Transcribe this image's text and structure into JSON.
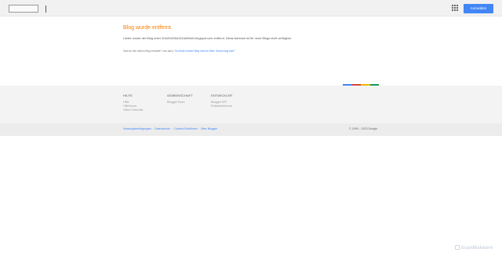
{
  "topbar": {
    "signin_label": "Anmelden",
    "apps_icon": "apps-grid-icon"
  },
  "main": {
    "title": "Blog wurde entfernt.",
    "message": "Leider wurde der Blog unter 2i1s00d23st1244e00s0l.blogspot.com entfernt. Diese Adresse ist für neue Blogs nicht verfügbar.",
    "hint_prefix": "Hast du hier deinen Blog erwartet? Lies dazu: ",
    "hint_link": "\"Ich finde meinen Blog nicht im Web. Woran liegt das?\""
  },
  "colors": {
    "accent_blue": "#4285f4",
    "title_orange": "#f57d00",
    "bar": [
      "#4285f4",
      "#db4437",
      "#f4b400",
      "#0f9d58"
    ]
  },
  "footer": {
    "columns": [
      {
        "heading": "HILFE",
        "links": [
          "Hilfe",
          "Hilfeforum",
          "Video-Tutorials"
        ]
      },
      {
        "heading": "GEMEINSCHAFT",
        "links": [
          "Blogger Buzz"
        ]
      },
      {
        "heading": "ENTWICKLER",
        "links": [
          "Blogger API",
          "Entwicklerforum"
        ]
      }
    ]
  },
  "legal": {
    "links": [
      "Nutzungsbedingungen",
      "Datenschutz",
      "Content-Richtlinien",
      "Über Blogger"
    ],
    "copyright": "© 1999 – 2023 Google"
  },
  "watermark": "ScanMalware"
}
